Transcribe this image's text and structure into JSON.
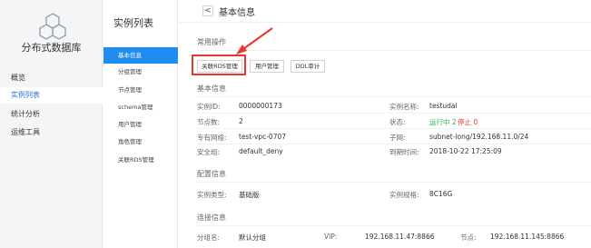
{
  "nav": {
    "product_name": "分布式数据库",
    "items": [
      {
        "label": "概览"
      },
      {
        "label": "实例列表"
      },
      {
        "label": "统计分析"
      },
      {
        "label": "运维工具"
      }
    ]
  },
  "subnav": {
    "title": "实例列表",
    "items": [
      {
        "label": "基本信息"
      },
      {
        "label": "分组管理"
      },
      {
        "label": "节点管理"
      },
      {
        "label": "schema管理"
      },
      {
        "label": "用户管理"
      },
      {
        "label": "角色管理"
      },
      {
        "label": "关联RDS管理"
      }
    ]
  },
  "header": {
    "back_glyph": "<",
    "title": "基本信息"
  },
  "common_ops": {
    "title": "常用操作",
    "buttons": [
      {
        "label": "关联RDS管理"
      },
      {
        "label": "用户管理"
      },
      {
        "label": "DDL审计"
      }
    ]
  },
  "basic_info": {
    "title": "基本信息",
    "instance_id_label": "实例ID:",
    "instance_id": "0000000173",
    "instance_name_label": "实例名称:",
    "instance_name": "testudal",
    "node_count_label": "节点数:",
    "node_count": "2",
    "status_label": "状态:",
    "running_text": "运行中 2",
    "stopped_text": "停止 0",
    "vpc_label": "专有网络:",
    "vpc": "test-vpc-0707",
    "subnet_label": "子网:",
    "subnet": "subnet-long/192.168.11.0/24",
    "security_group_label": "安全组:",
    "security_group": "default_deny",
    "expire_label": "到期时间:",
    "expire_time": "2018-10-22 17:25:09"
  },
  "config_info": {
    "title": "配置信息",
    "type_label": "实例类型:",
    "type_value": "基础版",
    "spec_label": "实例规格:",
    "spec_value": "8C16G"
  },
  "connection_info": {
    "title": "连接信息",
    "group_label": "分组名:",
    "group_value": "默认分组",
    "vip_label": "VIP:",
    "vip_value": "192.168.11.47:8866",
    "node_label": "节点:",
    "node_value": "192.168.11.145:8866"
  },
  "colors": {
    "accent": "#1f8cf0",
    "highlight": "#e8362d",
    "running": "#2bb24c"
  }
}
